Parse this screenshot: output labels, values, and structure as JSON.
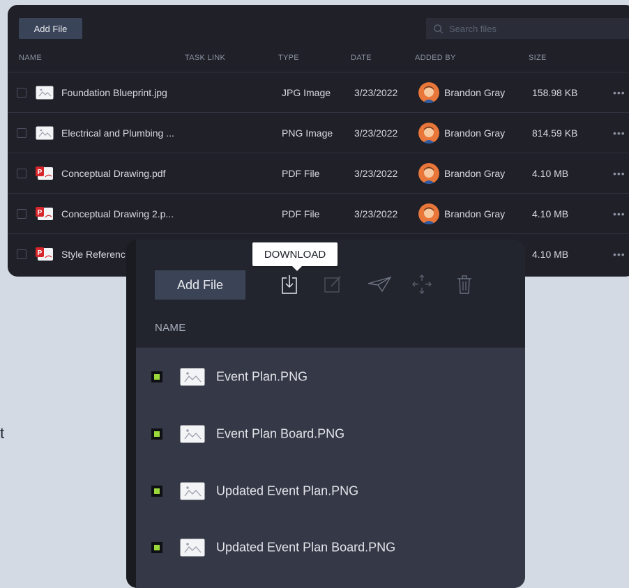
{
  "background_text": "t",
  "back_panel": {
    "add_file_label": "Add File",
    "search_placeholder": "Search files",
    "columns": {
      "name": "NAME",
      "task_link": "TASK LINK",
      "type": "TYPE",
      "date": "DATE",
      "added_by": "ADDED BY",
      "size": "SIZE"
    },
    "rows": [
      {
        "name": "Foundation Blueprint.jpg",
        "type": "JPG Image",
        "date": "3/23/2022",
        "added_by": "Brandon Gray",
        "size": "158.98 KB",
        "icon": "image-file-icon"
      },
      {
        "name": "Electrical and Plumbing ...",
        "type": "PNG Image",
        "date": "3/23/2022",
        "added_by": "Brandon Gray",
        "size": "814.59 KB",
        "icon": "image-file-icon"
      },
      {
        "name": "Conceptual Drawing.pdf",
        "type": "PDF File",
        "date": "3/23/2022",
        "added_by": "Brandon Gray",
        "size": "4.10 MB",
        "icon": "pdf-file-icon"
      },
      {
        "name": "Conceptual Drawing 2.p...",
        "type": "PDF File",
        "date": "3/23/2022",
        "added_by": "Brandon Gray",
        "size": "4.10 MB",
        "icon": "pdf-file-icon"
      },
      {
        "name": "Style Referenc",
        "type": "",
        "date": "",
        "added_by": "",
        "size": "4.10 MB",
        "icon": "pdf-file-icon"
      }
    ],
    "more_glyph": "•••"
  },
  "front_panel": {
    "add_file_label": "Add File",
    "tooltip": "DOWNLOAD",
    "name_header": "NAME",
    "rows": [
      {
        "name": "Event Plan.PNG"
      },
      {
        "name": "Event Plan Board.PNG"
      },
      {
        "name": "Updated Event Plan.PNG"
      },
      {
        "name": "Updated Event Plan Board.PNG"
      }
    ]
  },
  "colors": {
    "panel_bg": "#1f2028",
    "accent_green": "#9bd93a",
    "pdf_red": "#d7262b",
    "avatar_orange": "#e9773a"
  }
}
